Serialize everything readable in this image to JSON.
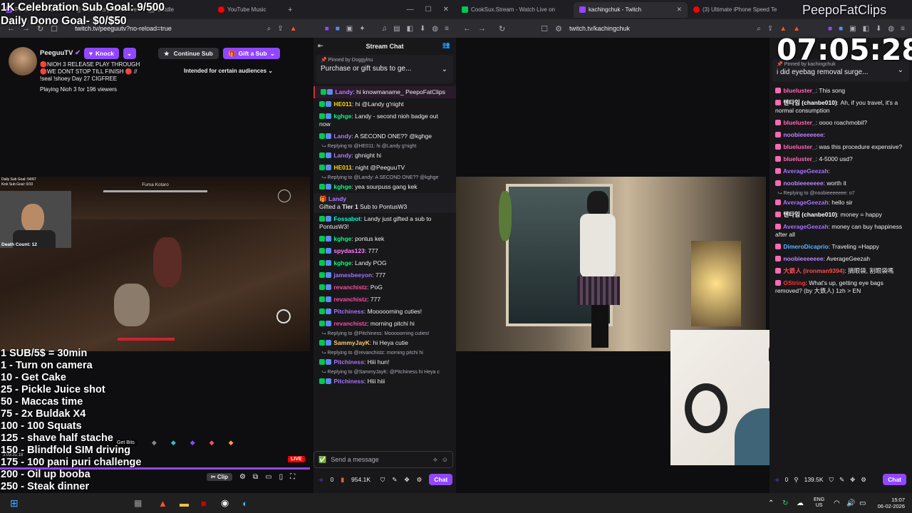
{
  "overlay": {
    "sub_goal": "1K Celebration Sub Goal: 9/500",
    "dono_goal": "Daily Dono Goal- $0/$50",
    "clock": "07:05:28",
    "clip_brand": "PeepoFatClips"
  },
  "left_browser": {
    "tabs": [
      {
        "label": "Pokimane - Twitch",
        "color": "#9147ff"
      },
      {
        "label": "Lostloots | Interactive",
        "color": "#3a3a3d"
      },
      {
        "label": "Listdle",
        "color": "#3a3a3d"
      },
      {
        "label": "YouTube Music",
        "color": "#ff0000"
      }
    ],
    "url": "twitch.tv/peeguutv?no-reload=true"
  },
  "right_browser": {
    "tabs": [
      {
        "label": "CookSux.Stream - Watch Live on",
        "color": "#00c853"
      },
      {
        "label": "kachingchuk - Twitch",
        "color": "#9147ff"
      },
      {
        "label": "(3) Ultimate iPhone Speed Te",
        "color": "#ff0000"
      }
    ],
    "url": "twitch.tv/kachingchuk"
  },
  "streamer": {
    "name": "PeeguuTV",
    "knock_label": "Knock",
    "title_lines": [
      "🔴NIOH 3 RELEASE PLAY THROUGH",
      "🔴WE DONT STOP TILL FINISH 🔴 //",
      "!seal !shoey Day 27 CIGFREE"
    ],
    "playing": "Playing Nioh 3 for 196 viewers",
    "continue_sub": "Continue Sub",
    "gift_sub": "Gift a Sub",
    "audience": "Intended for certain audiences"
  },
  "game": {
    "boss_name": "Fuma Kotaro",
    "death_counter": "Death Count: 12",
    "mini_goal_1": "Daily Sub Goal: 54/67",
    "mini_goal_2": "Kick Sub Goal: 0/10"
  },
  "goal_list": [
    "1 SUB/5$ = 30min",
    "1 - Turn on camera",
    "10 - Get Cake",
    "25 - Pickle Juice shot",
    "50 - Maccas time",
    "75 - 2x Buldak X4",
    "100 - 100 Squats",
    "125 - shave half stache",
    "150 - Blindfold SIM driving",
    "175 - 100 pani puri challenge",
    "200 - Oil up booba",
    "250 - Steak dinner",
    "500 - Baldge"
  ],
  "player_controls": {
    "live_badge": "LIVE",
    "get_bits": "Get Bits",
    "clip": "Clip",
    "stream_time": "3:05:31:18"
  },
  "left_chat": {
    "title": "Stream Chat",
    "pinned_by": "Pinned by",
    "pinned_user": "Doggylnu",
    "pinned_message": "Purchase or gift subs to ge...",
    "messages": [
      {
        "user": "Landy",
        "color": "#ad7bff",
        "text": "hi knowmaname_ PeepoFatClips",
        "highlight": true
      },
      {
        "user": "HE011",
        "color": "#ffd400",
        "text": "hi @Landy g'night"
      },
      {
        "user": "kghge",
        "color": "#00ff7f",
        "text": "Landy - second nioh badge out now"
      },
      {
        "user": "Landy",
        "color": "#ad7bff",
        "text": "A SECOND ONE?? @kghge"
      },
      {
        "reply": "Replying to @HE011: hi @Landy g'night",
        "user": "Landy",
        "color": "#ad7bff",
        "text": "ghnight hi"
      },
      {
        "user": "HE011",
        "color": "#ffd400",
        "text": "night @PeeguuTV"
      },
      {
        "reply": "Replying to @Landy: A SECOND ONE?? @kghge",
        "user": "kghge",
        "color": "#00ff7f",
        "text": "yea sourpuss gang kek"
      }
    ],
    "gift": {
      "user": "Landy",
      "text_prefix": "Gifted a",
      "tier": "Tier 1",
      "text_suffix": "Sub to PontusW3"
    },
    "messages2": [
      {
        "user": "Fossabot",
        "color": "#00ffd5",
        "text": "Landy just gifted a sub to PontusW3!"
      },
      {
        "user": "kghge",
        "color": "#00ff7f",
        "text": "pontus kek"
      },
      {
        "user": "spydas123",
        "color": "#ff7fff",
        "text": "777"
      },
      {
        "user": "kghge",
        "color": "#00ff7f",
        "text": "Landy POG"
      },
      {
        "user": "jamesbeeyon",
        "color": "#a970ff",
        "text": "777"
      },
      {
        "user": "revanchistz",
        "color": "#ff4aa0",
        "text": "PoG"
      },
      {
        "user": "revanchistz",
        "color": "#ff4aa0",
        "text": "777"
      },
      {
        "user": "Pitchiness",
        "color": "#a970ff",
        "text": "Mooooorning cuties!"
      },
      {
        "user": "revanchistz",
        "color": "#ff4aa0",
        "text": "morning pitchi hi"
      },
      {
        "reply": "Replying to @Pitchiness: Mooooorning cuties!",
        "user": "SammyJayK",
        "color": "#ffcc66",
        "text": "hi Heya cutie"
      },
      {
        "reply": "Replying to @revanchistz: morning pitchi hi",
        "user": "Pitchiness",
        "color": "#a970ff",
        "text": "Hiii hun!"
      },
      {
        "reply": "Replying to @SammyJayK: @Pitchiness hi Heya c",
        "user": "Pitchiness",
        "color": "#a970ff",
        "text": "Hiii hiii"
      }
    ],
    "input_placeholder": "Send a message",
    "points_count": "0",
    "bits_count": "954.1K",
    "chat_button": "Chat"
  },
  "right_chat": {
    "pinned_by": "Pinned by",
    "pinned_user": "kachingchuk",
    "pinned_message": "i did eyebag removal surge...",
    "messages": [
      {
        "user": "blueluster_",
        "color": "#ff69b4",
        "text": "This song"
      },
      {
        "user": "텐타임 (chanbe010)",
        "color": "#ffffff",
        "text": "Ah, if you travel, it's a normal consumption"
      },
      {
        "user": "blueluster_",
        "color": "#ff69b4",
        "text": "oooo roachmobil?"
      },
      {
        "user": "noobieeeeeee",
        "color": "#c084fc",
        "text": ""
      },
      {
        "user": "blueluster_",
        "color": "#ff69b4",
        "text": "was this procedure expensive?"
      },
      {
        "user": "blueluster_",
        "color": "#ff69b4",
        "text": "4-5000 usd?"
      },
      {
        "user": "AverageGeezah",
        "color": "#a970ff",
        "text": ""
      },
      {
        "user": "noobieeeeeee",
        "color": "#c084fc",
        "text": "worth it"
      },
      {
        "reply": "Replying to @noobieeeeeee: o7",
        "user": "AverageGeezah",
        "color": "#a970ff",
        "text": "hello sir"
      },
      {
        "user": "텐타임 (chanbe010)",
        "color": "#ffffff",
        "text": "money = happy"
      },
      {
        "user": "AverageGeezah",
        "color": "#a970ff",
        "text": "money can buy happiness after all"
      },
      {
        "user": "DimeroDicaprio",
        "color": "#5ab4ff",
        "text": "Traveling =Happy"
      },
      {
        "user": "noobieeeeeee",
        "color": "#c084fc",
        "text": "AverageGeezah"
      },
      {
        "user": "大鉄人 (ironman9394)",
        "color": "#ff4a4a",
        "text": "摘眼袋, 割眼袋嗎"
      },
      {
        "user": "OString",
        "color": "#ff3030",
        "text": "What's up, getting eye bags removed? (by 大鉄人) 1zh > EN"
      }
    ],
    "points_count": "0",
    "bits_count": "139.5K",
    "chat_button": "Chat"
  },
  "taskbar": {
    "lang_top": "ENG",
    "lang_bottom": "US",
    "time": "15:07",
    "date": "06-02-2026"
  }
}
